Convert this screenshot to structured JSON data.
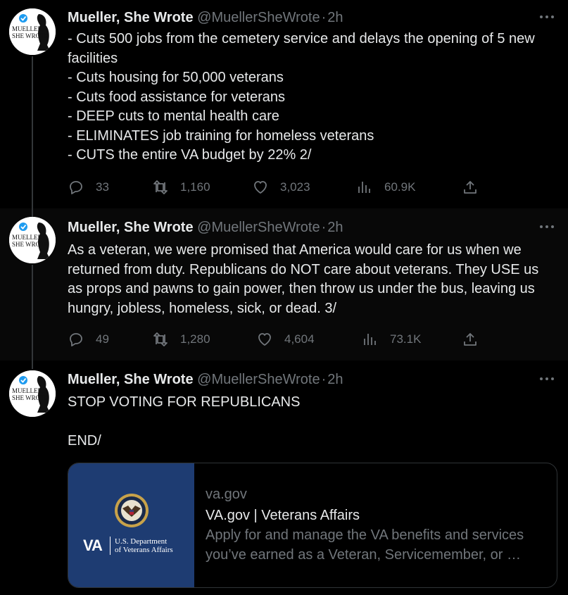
{
  "tweets": [
    {
      "author": {
        "name": "Mueller, She Wrote",
        "handle": "@MuellerSheWrote",
        "time": "2h",
        "avatar_text": "MUELLER, SHE WROTE"
      },
      "lines": [
        "- Cuts 500 jobs from the cemetery service and delays the opening of 5 new facilities",
        "- Cuts housing for 50,000 veterans",
        "- Cuts food assistance for veterans",
        "- DEEP cuts to mental health care",
        "- ELIMINATES job training for homeless veterans",
        "- CUTS the entire VA budget by 22% 2/"
      ],
      "stats": {
        "replies": "33",
        "retweets": "1,160",
        "likes": "3,023",
        "views": "60.9K"
      }
    },
    {
      "author": {
        "name": "Mueller, She Wrote",
        "handle": "@MuellerSheWrote",
        "time": "2h",
        "avatar_text": "MUELLER, SHE WROTE"
      },
      "lines": [
        "As a veteran, we were promised that America would care for us when we returned from duty. Republicans do NOT care about veterans. They USE us as props and pawns to gain power, then throw us under the bus, leaving us hungry, jobless, homeless,  sick, or dead. 3/"
      ],
      "stats": {
        "replies": "49",
        "retweets": "1,280",
        "likes": "4,604",
        "views": "73.1K"
      }
    },
    {
      "author": {
        "name": "Mueller, She Wrote",
        "handle": "@MuellerSheWrote",
        "time": "2h",
        "avatar_text": "MUELLER, SHE WROTE"
      },
      "lines": [
        "STOP VOTING FOR REPUBLICANS",
        "",
        "END/"
      ],
      "card": {
        "domain": "va.gov",
        "title": "VA.gov | Veterans Affairs",
        "description": "Apply for and manage the VA benefits and services you’ve earned as a Veteran, Servicemember, or …",
        "logo_text": "VA",
        "dept_line1": "U.S. Department",
        "dept_line2": "of Veterans Affairs"
      }
    }
  ],
  "icons": {
    "reply": "reply-icon",
    "retweet": "retweet-icon",
    "like": "heart-icon",
    "views": "views-icon",
    "share": "share-icon",
    "more": "more-icon",
    "verified": "verified-badge-icon"
  },
  "colors": {
    "background": "#000000",
    "text": "#e7e9ea",
    "muted": "#71767b",
    "verified": "#1d9bf0",
    "va_blue": "#1e3c72"
  }
}
